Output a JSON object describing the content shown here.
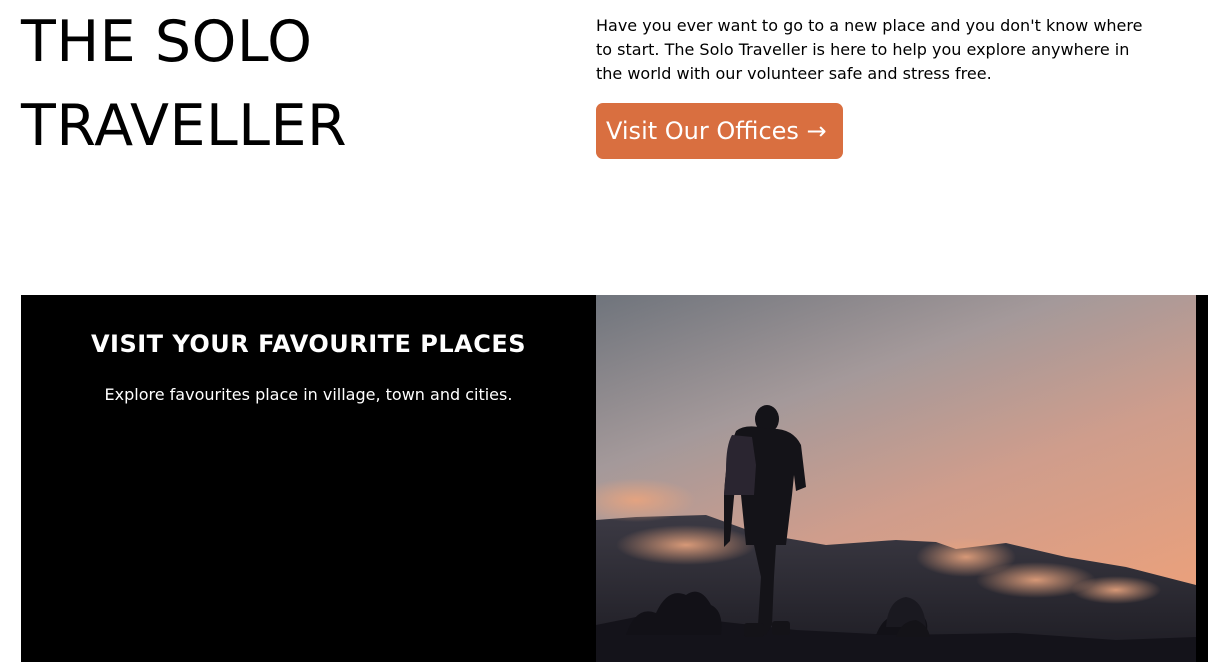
{
  "hero": {
    "title_line1": "THE SOLO",
    "title_line2": "TRAVELLER",
    "intro": "Have you ever want to go to a new place and you don't know where to start. The Solo Traveller is here to help you explore anywhere in the world with our volunteer safe and stress free.",
    "cta_label": "Visit Our Offices →"
  },
  "feature": {
    "heading": "VISIT YOUR FAVOURITE PLACES",
    "description": "Explore favourites place in village, town and cities."
  },
  "colors": {
    "accent": "#d96f40",
    "feature_bg": "#000000"
  }
}
